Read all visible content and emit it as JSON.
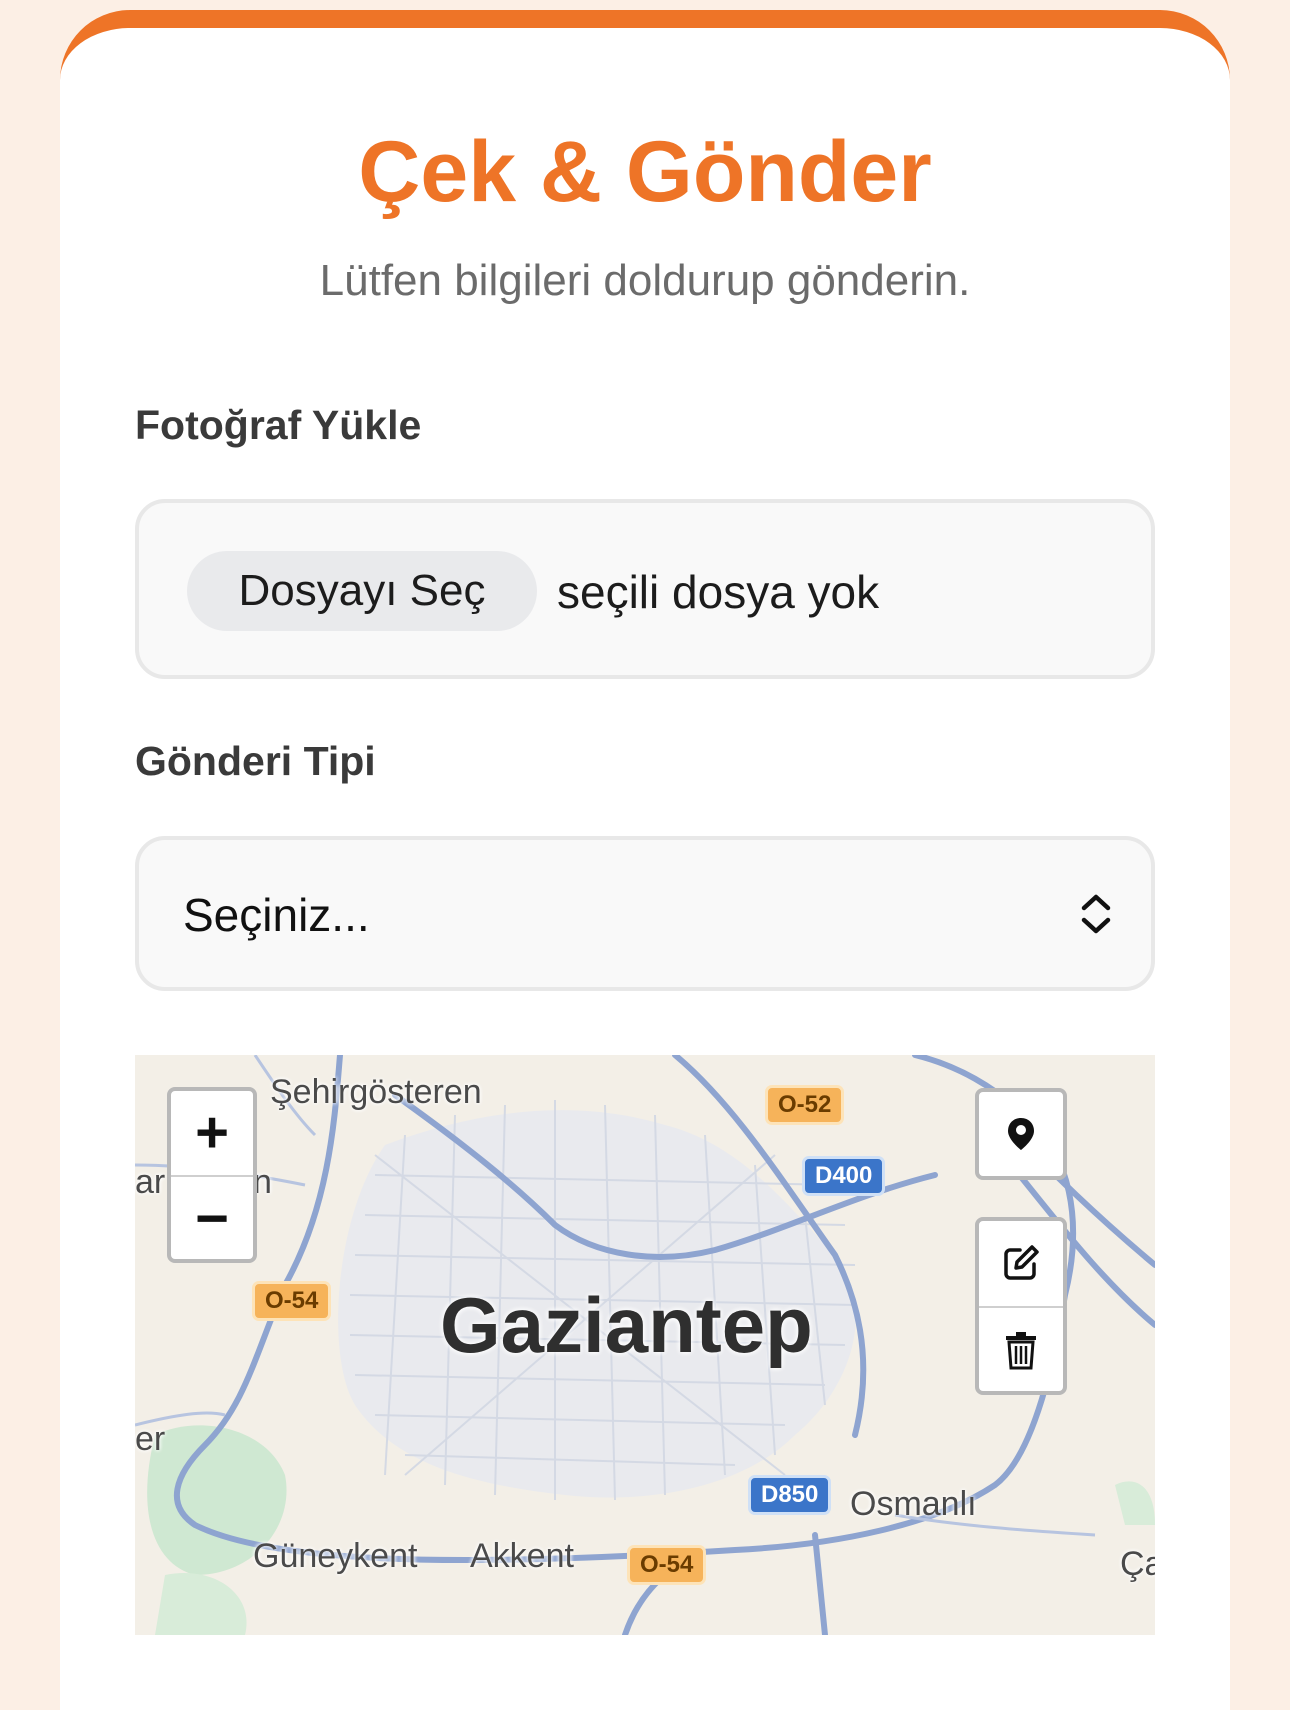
{
  "header": {
    "title": "Çek & Gönder",
    "subtitle": "Lütfen bilgileri doldurup gönderin."
  },
  "photo_upload": {
    "label": "Fotoğraf Yükle",
    "button_label": "Dosyayı Seç",
    "status_text": "seçili dosya yok"
  },
  "post_type": {
    "label": "Gönderi Tipi",
    "selected_value": "Seçiniz..."
  },
  "map": {
    "city_label": "Gaziantep",
    "place_labels": {
      "north": "Şehirgösteren",
      "southwest": "Güneykent",
      "south": "Akkent",
      "southeast": "Osmanlı",
      "edge_left_top": "ar",
      "edge_left_top_right": "n",
      "edge_left_bottom": "er",
      "edge_right": "Ça"
    },
    "road_shields": {
      "o52": "O-52",
      "d400": "D400",
      "o54_west": "O-54",
      "d850": "D850",
      "o54_south": "O-54"
    },
    "controls": {
      "zoom_in": "+",
      "zoom_out": "−",
      "marker_tool_icon": "map-marker-icon",
      "edit_tool_icon": "edit-icon",
      "delete_tool_icon": "trash-icon"
    }
  },
  "colors": {
    "accent": "#ee7427",
    "page_background": "#fcefe5",
    "card_background": "#ffffff",
    "subtitle_text": "#6b6b6b",
    "input_background": "#f9f9f9",
    "road_blue": "#7f97c8",
    "road_shield_orange": "#f6b35a",
    "road_shield_blue": "#3b75c9"
  }
}
